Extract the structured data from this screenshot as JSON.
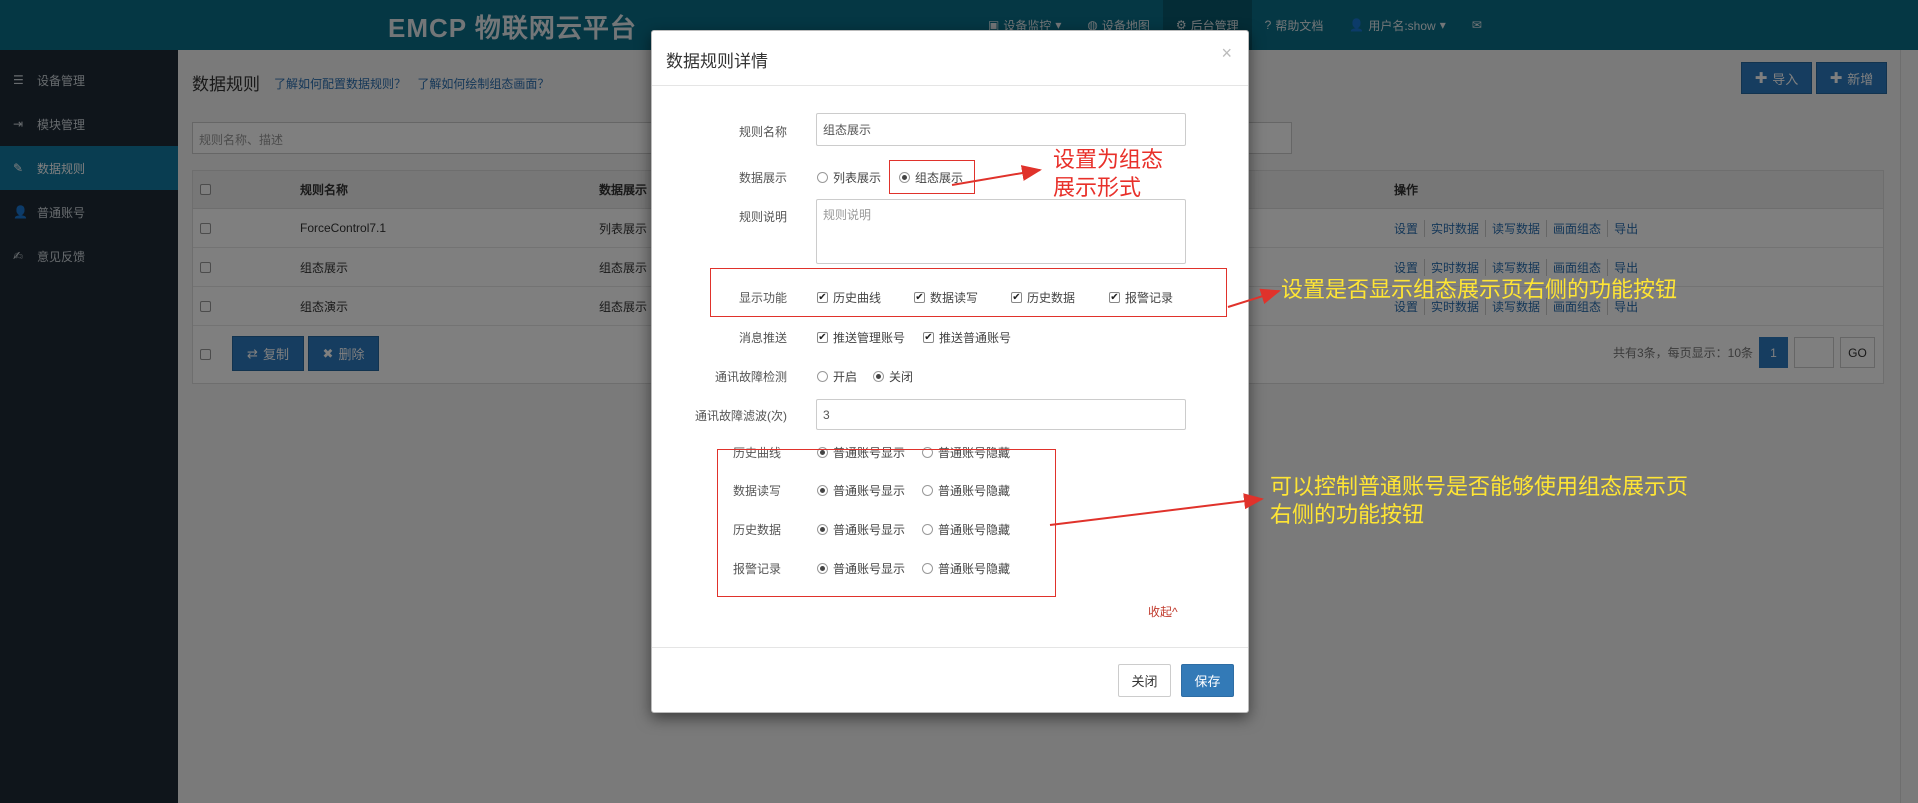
{
  "header": {
    "brand": "EMCP 物联网云平台",
    "nav": [
      {
        "label": "设备监控",
        "icon": "monitor-icon",
        "caret": true
      },
      {
        "label": "设备地图",
        "icon": "globe-icon",
        "caret": false
      },
      {
        "label": "后台管理",
        "icon": "gears-icon",
        "caret": false,
        "active": true
      },
      {
        "label": "帮助文档",
        "icon": "question-icon",
        "caret": false
      },
      {
        "label": "用户名:show",
        "icon": "user-icon",
        "caret": true
      },
      {
        "label": "",
        "icon": "mail-icon",
        "caret": false
      }
    ]
  },
  "sidebar": {
    "items": [
      {
        "label": "设备管理",
        "icon": "list-icon"
      },
      {
        "label": "模块管理",
        "icon": "sign-in-icon"
      },
      {
        "label": "数据规则",
        "icon": "pencil-icon",
        "active": true
      },
      {
        "label": "普通账号",
        "icon": "user-icon"
      },
      {
        "label": "意见反馈",
        "icon": "edit-icon"
      }
    ]
  },
  "page": {
    "title": "数据规则",
    "help_link_1": "了解如何配置数据规则？",
    "help_link_2": "了解如何绘制组态画面？",
    "import_label": "导入",
    "add_label": "新增",
    "search_placeholder": "规则名称、描述",
    "table": {
      "columns": [
        "规则名称",
        "数据展示",
        "操作"
      ],
      "rows": [
        {
          "name": "ForceControl7.1",
          "display": "列表展示"
        },
        {
          "name": "组态展示",
          "display": "组态展示"
        },
        {
          "name": "组态演示",
          "display": "组态展示"
        }
      ],
      "ops": [
        "设置",
        "实时数据",
        "读写数据",
        "画面组态",
        "导出"
      ]
    },
    "copy_label": "复制",
    "delete_label": "删除",
    "pager": {
      "summary": "共有3条，每页显示：10条",
      "current": "1",
      "go_label": "GO"
    }
  },
  "modal": {
    "title": "数据规则详情",
    "close_symbol": "×",
    "rule_name_label": "规则名称",
    "rule_name_value": "组态展示",
    "display_label": "数据展示",
    "display_options": [
      {
        "label": "列表展示",
        "checked": false
      },
      {
        "label": "组态展示",
        "checked": true
      }
    ],
    "desc_label": "规则说明",
    "desc_placeholder": "规则说明",
    "functions_label": "显示功能",
    "functions": [
      {
        "label": "历史曲线",
        "checked": true
      },
      {
        "label": "数据读写",
        "checked": true
      },
      {
        "label": "历史数据",
        "checked": true
      },
      {
        "label": "报警记录",
        "checked": true
      }
    ],
    "push_label": "消息推送",
    "push_options": [
      {
        "label": "推送管理账号",
        "checked": true
      },
      {
        "label": "推送普通账号",
        "checked": true
      }
    ],
    "fault_label": "通讯故障检测",
    "fault_options": [
      {
        "label": "开启",
        "checked": false
      },
      {
        "label": "关闭",
        "checked": true
      }
    ],
    "filter_label": "通讯故障滤波(次)",
    "filter_value": "3",
    "visibility": [
      {
        "label": "历史曲线",
        "show": "普通账号显示",
        "hide": "普通账号隐藏"
      },
      {
        "label": "数据读写",
        "show": "普通账号显示",
        "hide": "普通账号隐藏"
      },
      {
        "label": "历史数据",
        "show": "普通账号显示",
        "hide": "普通账号隐藏"
      },
      {
        "label": "报警记录",
        "show": "普通账号显示",
        "hide": "普通账号隐藏"
      }
    ],
    "collapse_label": "收起^",
    "close_button": "关闭",
    "save_button": "保存"
  },
  "annotations": {
    "display_note": "设置为组态\n展示形式",
    "functions_note": "设置是否显示组态展示页右侧的功能按钮",
    "visibility_note": "可以控制普通账号是否能够使用组态展示页\n右侧的功能按钮",
    "note_colors": {
      "red": "#e8302a",
      "yellow": "#ffe534",
      "box": "#e0322b"
    }
  }
}
